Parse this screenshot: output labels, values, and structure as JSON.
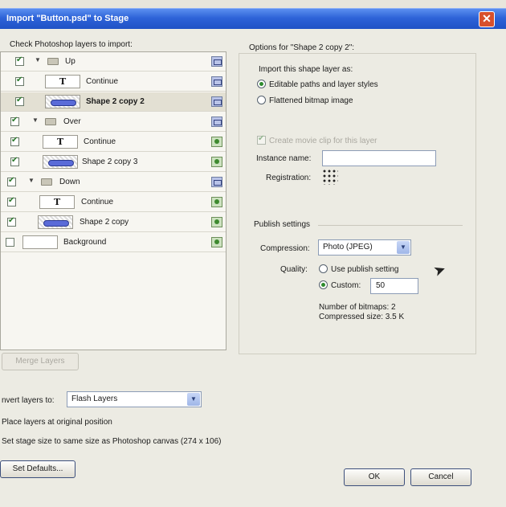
{
  "window": {
    "title": "Import \"Button.psd\" to Stage"
  },
  "layers": {
    "header": "Check Photoshop layers to import:",
    "rows": [
      {
        "name": "Up"
      },
      {
        "name": "Continue"
      },
      {
        "name": "Shape 2 copy 2"
      },
      {
        "name": "Over"
      },
      {
        "name": "Continue"
      },
      {
        "name": "Shape 2 copy 3"
      },
      {
        "name": "Down"
      },
      {
        "name": "Continue"
      },
      {
        "name": "Shape 2 copy"
      },
      {
        "name": "Background"
      }
    ]
  },
  "options": {
    "header": "Options for \"Shape 2 copy 2\":",
    "import_as_label": "Import this shape layer as:",
    "editable_label": "Editable paths and layer styles",
    "flattened_label": "Flattened bitmap image",
    "movie_clip_label": "Create movie clip for this layer",
    "instance_name_label": "Instance name:",
    "instance_name_value": "",
    "registration_label": "Registration:",
    "publish_header": "Publish settings",
    "compression_label": "Compression:",
    "compression_value": "Photo (JPEG)",
    "quality_label": "Quality:",
    "use_publish_label": "Use publish setting",
    "custom_label": "Custom:",
    "custom_value": "50",
    "bitmaps_text": "Number of bitmaps: 2",
    "compressed_text": "Compressed size: 3.5 K"
  },
  "bottom": {
    "merge_label": "Merge Layers",
    "convert_label": "nvert layers to:",
    "convert_value": "Flash Layers",
    "place_label": "Place layers at original position",
    "stage_size_label": "Set stage size to same size as Photoshop canvas (274 x 106)",
    "set_defaults_label": "Set Defaults...",
    "ok_label": "OK",
    "cancel_label": "Cancel"
  }
}
